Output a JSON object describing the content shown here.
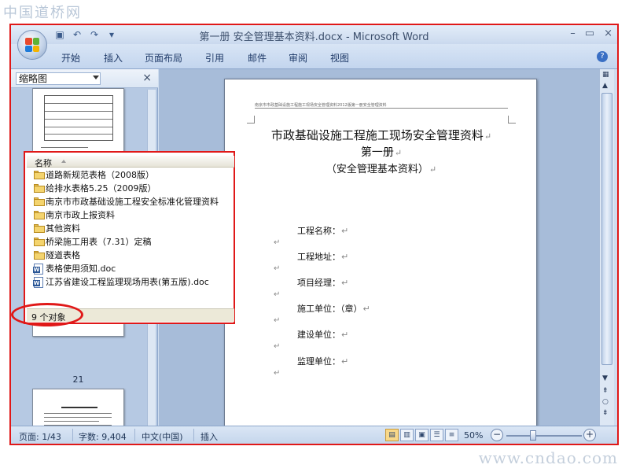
{
  "watermarks": {
    "top": "中国道桥网",
    "bottom": "www.cndao.com"
  },
  "window": {
    "title": "第一册  安全管理基本资料.docx - Microsoft Word",
    "controls": [
      "–",
      "▭",
      "×"
    ]
  },
  "ribbon": {
    "tabs": [
      "开始",
      "插入",
      "页面布局",
      "引用",
      "邮件",
      "审阅",
      "视图"
    ]
  },
  "thumbnails": {
    "label": "缩略图",
    "page_number": "21"
  },
  "document": {
    "header_text": "南京市市政基础设施工程施工现场安全管理资料2012版第一册安全管理资料",
    "title1": "市政基础设施工程施工现场安全管理资料",
    "title2": "第一册",
    "title3": "（安全管理基本资料）",
    "return_mark": "↵",
    "fields": [
      "工程名称：",
      "工程地址：",
      "项目经理：",
      "施工单位：（章）",
      "建设单位：",
      "监理单位："
    ]
  },
  "explorer": {
    "column_header": "名称",
    "items": [
      {
        "name": "道路新规范表格（2008版）",
        "type": "folder"
      },
      {
        "name": "给排水表格5.25（2009版）",
        "type": "folder"
      },
      {
        "name": "南京市市政基础设施工程安全标准化管理资料",
        "type": "folder"
      },
      {
        "name": "南京市政上报资料",
        "type": "folder"
      },
      {
        "name": "其他资料",
        "type": "folder"
      },
      {
        "name": "桥梁施工用表（7.31）定稿",
        "type": "folder"
      },
      {
        "name": "隧道表格",
        "type": "folder"
      },
      {
        "name": "表格使用须知.doc",
        "type": "word"
      },
      {
        "name": "江苏省建设工程监理现场用表(第五版).doc",
        "type": "word"
      }
    ],
    "status": "9 个对象"
  },
  "statusbar": {
    "page": "页面: 1/43",
    "words": "字数: 9,404",
    "language": "中文(中国)",
    "mode": "插入",
    "zoom": "50%"
  },
  "colors": {
    "highlight_red": "#e01818",
    "ribbon_text": "#1f3a68",
    "office_logo": [
      "#e8492d",
      "#5fb336",
      "#1f7bd9",
      "#f4b400"
    ]
  }
}
